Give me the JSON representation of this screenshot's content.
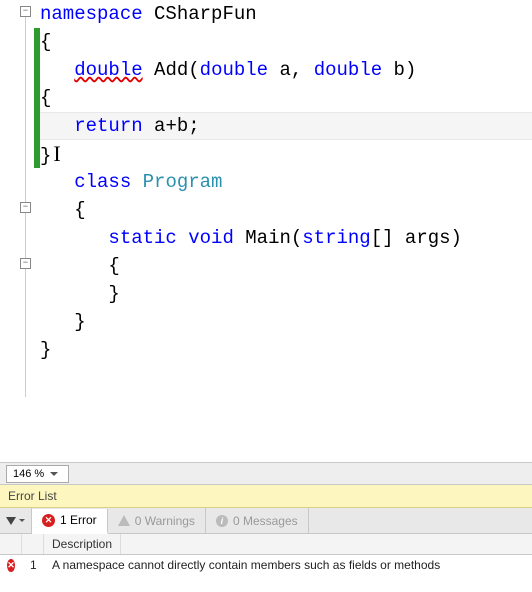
{
  "code": {
    "l0": {
      "kw": "namespace",
      "name": "CSharpFun"
    },
    "l1": "{",
    "l2": {
      "ret": "double",
      "fn": "Add",
      "a1t": "double",
      "a1n": "a",
      "a2t": "double",
      "a2n": "b"
    },
    "l3": "{",
    "l4": {
      "kw": "return",
      "expr": "a+b;"
    },
    "l5": "}",
    "l6": {
      "kw": "class",
      "name": "Program"
    },
    "l7": "{",
    "l8": {
      "kw1": "static",
      "kw2": "void",
      "fn": "Main",
      "pt": "string",
      "arr": "[]",
      "pn": "args"
    },
    "l9": "{",
    "l10": "}",
    "l11": "}",
    "l12": "}"
  },
  "zoom": {
    "level": "146 %"
  },
  "errorlist": {
    "title": "Error List",
    "tabs": {
      "errors": "1 Error",
      "warnings": "0 Warnings",
      "messages": "0 Messages"
    },
    "columns": {
      "desc": "Description"
    },
    "items": [
      {
        "num": "1",
        "desc": "A namespace cannot directly contain members such as fields or methods"
      }
    ]
  }
}
